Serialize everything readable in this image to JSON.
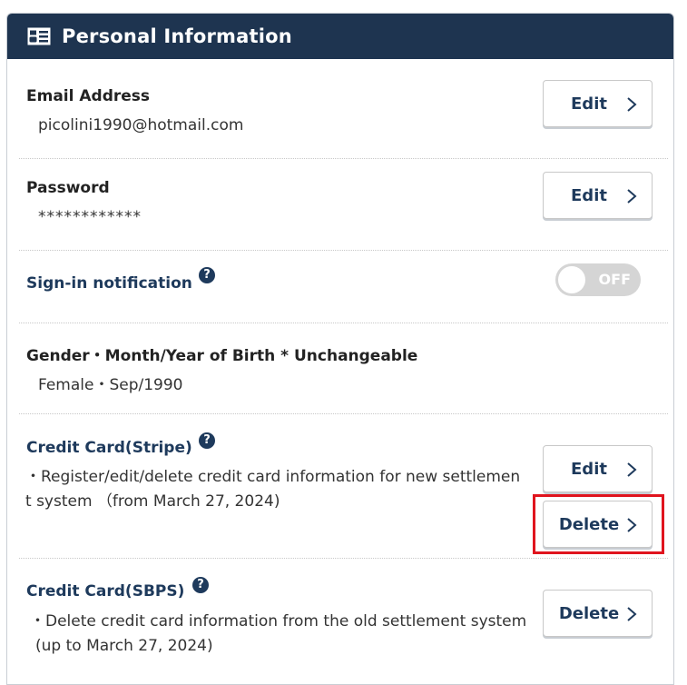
{
  "header": {
    "title": "Personal  Information",
    "icon": "profile-card-icon"
  },
  "email": {
    "label": "Email Address",
    "value": "picolini1990@hotmail.com",
    "button": "Edit"
  },
  "password": {
    "label": "Password",
    "value": "************",
    "button": "Edit"
  },
  "signin": {
    "label": "Sign-in notification",
    "toggle": "OFF",
    "help_icon": "question-circle-icon"
  },
  "gender": {
    "label": "Gender・Month/Year of Birth * Unchangeable",
    "value": "Female・Sep/1990"
  },
  "stripe": {
    "label": "Credit Card(Stripe)",
    "desc_line1": "・Register/edit/delete credit card information for new settlemen",
    "desc_line2": "t system （from March 27, 2024)",
    "edit_button": "Edit",
    "delete_button": "Delete"
  },
  "sbps": {
    "label": "Credit Card(SBPS)",
    "desc_line1": "・Delete credit card information from the old settlement system",
    "desc_line2": "(up to March 27, 2024)",
    "delete_button": "Delete"
  },
  "colors": {
    "header_bg": "#1e3450",
    "accent": "#1e3a5c",
    "highlight": "#e0141e"
  }
}
